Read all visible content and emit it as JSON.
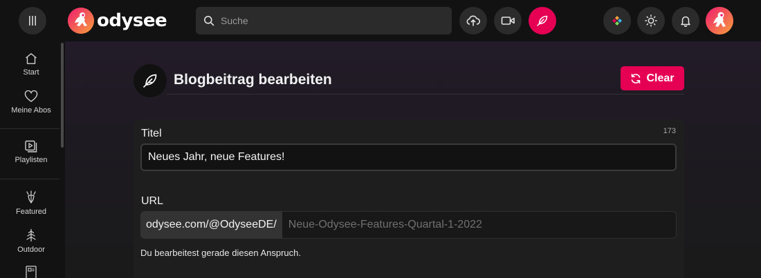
{
  "header": {
    "logo_text": "odysee",
    "search_placeholder": "Suche",
    "icons": [
      "menu-icon",
      "upload-icon",
      "video-icon",
      "feather-icon",
      "apps-icon",
      "theme-icon",
      "bell-icon"
    ],
    "accent_color": "#e50054"
  },
  "sidebar": {
    "items": [
      {
        "label": "Start",
        "icon": "home-icon"
      },
      {
        "label": "Meine Abos",
        "icon": "heart-icon"
      },
      {
        "label": "Playlisten",
        "icon": "playlist-icon"
      },
      {
        "label": "Featured",
        "icon": "featured-icon"
      },
      {
        "label": "Outdoor",
        "icon": "tree-icon"
      }
    ]
  },
  "main": {
    "page_title": "Blogbeitrag bearbeiten",
    "clear_label": "Clear",
    "title_field": {
      "label": "Titel",
      "counter": "173",
      "value": "Neues Jahr, neue Features!"
    },
    "url_field": {
      "label": "URL",
      "prefix": "odysee.com/@OdyseeDE/",
      "placeholder": "Neue-Odysee-Features-Quartal-1-2022"
    },
    "help_text": "Du bearbeitest gerade diesen Anspruch."
  }
}
